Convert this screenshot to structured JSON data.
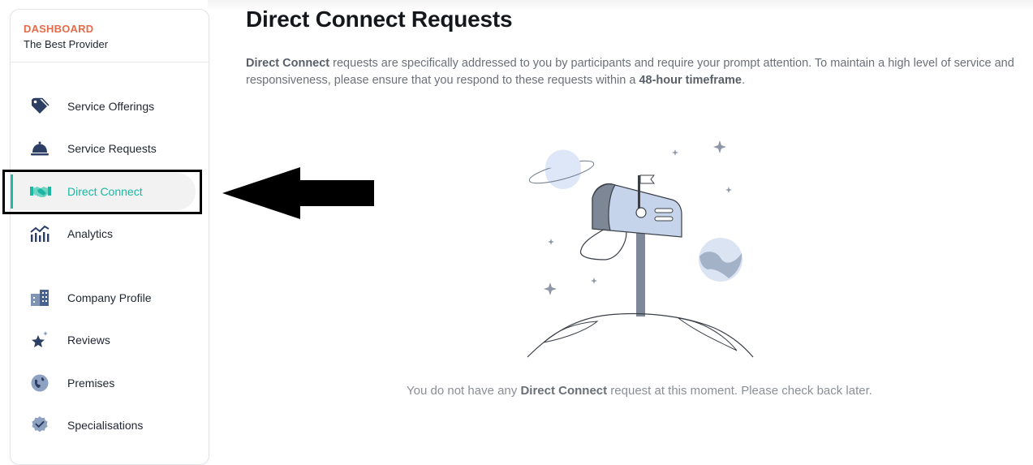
{
  "sidebar": {
    "dashboard_label": "DASHBOARD",
    "provider_name": "The Best Provider",
    "items": [
      {
        "label": "Service Offerings",
        "icon": "tag-icon"
      },
      {
        "label": "Service Requests",
        "icon": "service-bell-icon"
      },
      {
        "label": "Direct Connect",
        "icon": "handshake-icon",
        "active": true
      },
      {
        "label": "Analytics",
        "icon": "analytics-chart-icon"
      },
      {
        "label": "Company Profile",
        "icon": "building-icon"
      },
      {
        "label": "Reviews",
        "icon": "star-sparkle-icon"
      },
      {
        "label": "Premises",
        "icon": "globe-icon"
      },
      {
        "label": "Specialisations",
        "icon": "badge-check-icon"
      }
    ]
  },
  "main": {
    "title": "Direct Connect Requests",
    "intro": {
      "part1_bold": "Direct Connect",
      "part2": " requests are specifically addressed to you by participants and require your prompt attention. To maintain a high level of service and responsiveness, please ensure that you respond to these requests within a ",
      "part3_bold": "48-hour timeframe",
      "part4": "."
    },
    "empty_state": {
      "part1": "You do not have any ",
      "part2_bold": "Direct Connect",
      "part3": " request at this moment. Please check back later.",
      "illustration": "mailbox-on-planet-illustration"
    }
  },
  "colors": {
    "brand_orange": "#e56c4a",
    "active_teal": "#1ab7a2",
    "icon_navy": "#2c3e63"
  }
}
